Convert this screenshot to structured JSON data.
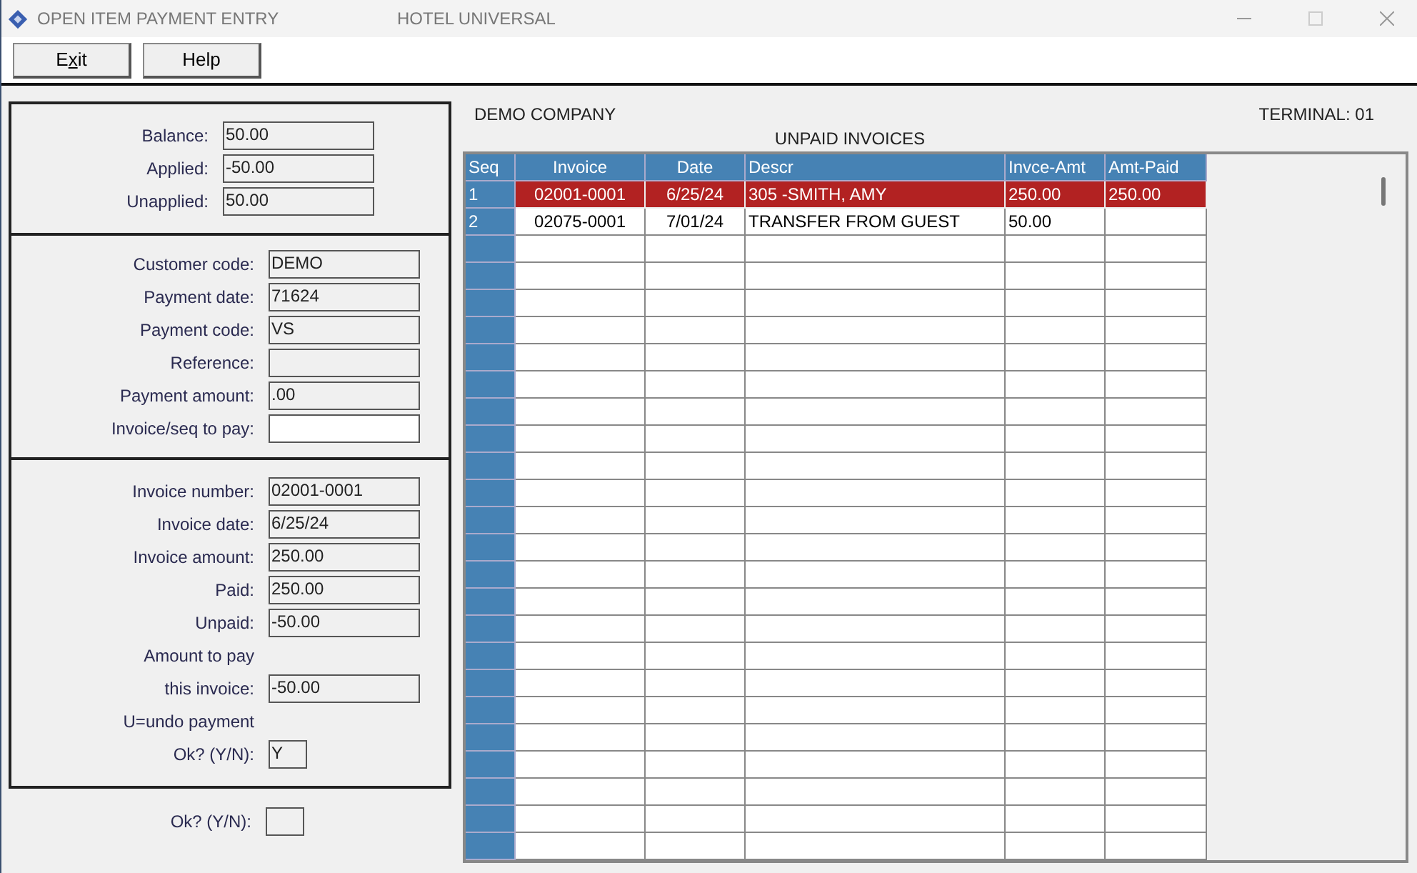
{
  "window": {
    "title": "OPEN ITEM PAYMENT ENTRY",
    "subtitle": "HOTEL UNIVERSAL"
  },
  "toolbar": [
    {
      "label": "E",
      "access_key": "x",
      "label_rest": "it"
    },
    {
      "label": "Help"
    }
  ],
  "sections": [
    {
      "fields": [
        {
          "label": "Balance:",
          "value": "50.00"
        },
        {
          "label": "Applied:",
          "value": "-50.00"
        },
        {
          "label": "Unapplied:",
          "value": "50.00"
        }
      ]
    },
    {
      "fields": [
        {
          "label": "Customer code:",
          "value": "DEMO"
        },
        {
          "label": "Payment date:",
          "value": "71624"
        },
        {
          "label": "Payment code:",
          "value": "VS"
        },
        {
          "label": "Reference:"
        },
        {
          "label": "Payment amount:",
          "value": ".00"
        },
        {
          "label": "Invoice/seq to pay:",
          "editable": true
        }
      ]
    },
    {
      "fields": [
        {
          "label": "Invoice number:",
          "value": "02001-0001"
        },
        {
          "label": "Invoice date:",
          "value": "6/25/24"
        },
        {
          "label": "Invoice amount:",
          "value": "250.00"
        },
        {
          "label": "Paid:",
          "value": "250.00"
        },
        {
          "label": "Unpaid:",
          "value": "-50.00"
        },
        {
          "label": "Amount to pay",
          "kind": "caption"
        },
        {
          "label": "this invoice:",
          "value": "-50.00"
        },
        {
          "label": "U=undo payment",
          "kind": "caption"
        },
        {
          "label": "Ok? (Y/N):",
          "value": "Y",
          "kind": "short"
        }
      ]
    }
  ],
  "confirm": {
    "label": "Ok? (Y/N):"
  },
  "company": "DEMO COMPANY",
  "terminal": "TERMINAL: 01",
  "table": {
    "title": "UNPAID INVOICES",
    "columns": [
      "Seq",
      "Invoice",
      "Date",
      "Descr",
      "Invce-Amt",
      "Amt-Paid"
    ],
    "rows": [
      {
        "cells": [
          "1",
          "02001-0001",
          "6/25/24",
          "305 -SMITH, AMY",
          "250.00",
          "250.00"
        ],
        "selected": true
      },
      {
        "cells": [
          "2",
          "02075-0001",
          "7/01/24",
          "TRANSFER FROM GUEST",
          "50.00",
          ""
        ],
        "selected": false
      }
    ]
  }
}
